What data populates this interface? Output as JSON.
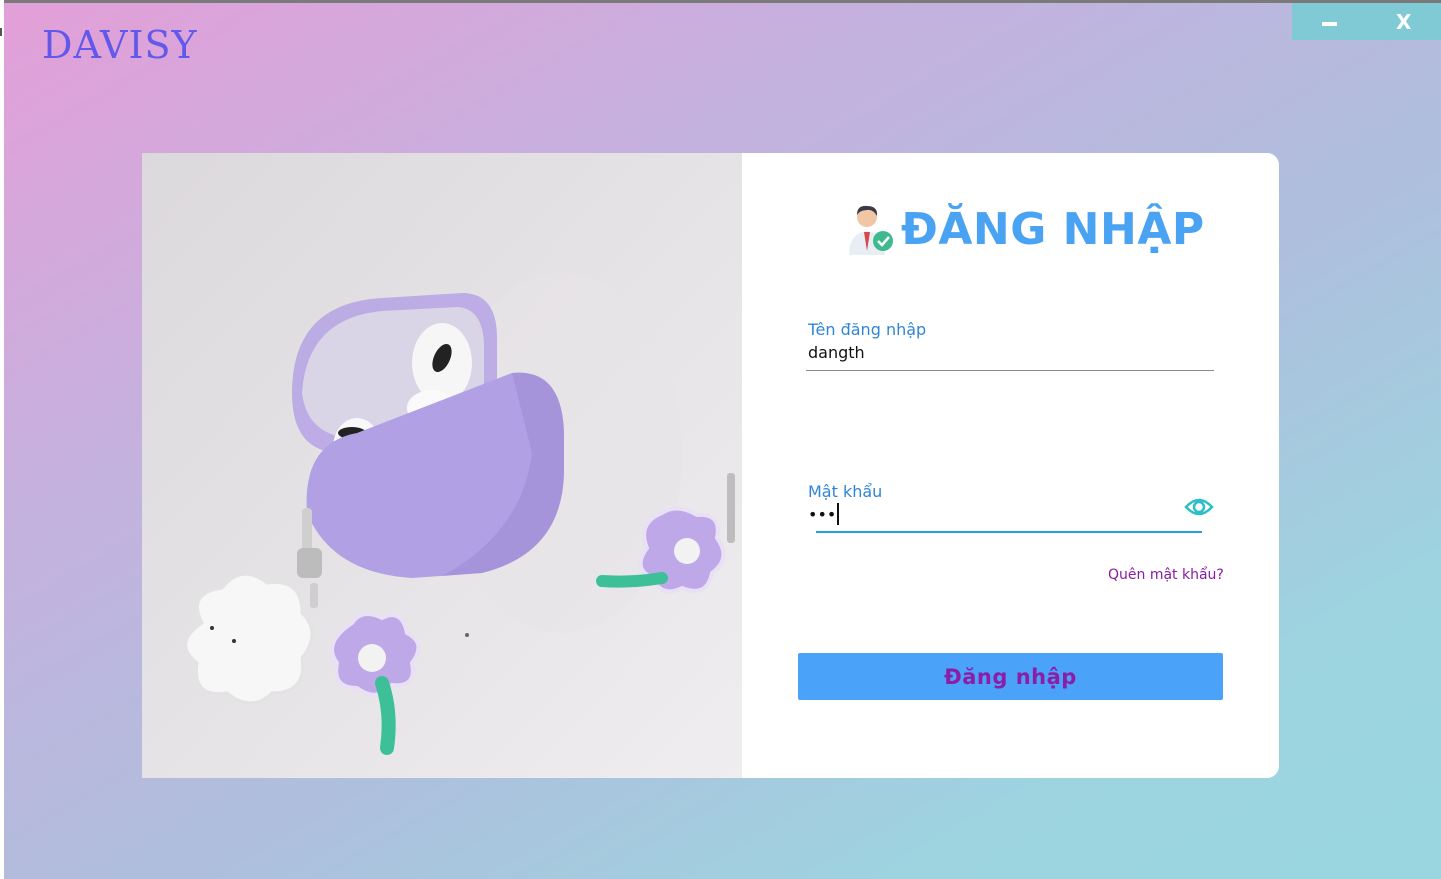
{
  "app": {
    "brand": "DAVISY"
  },
  "window_controls": {
    "minimize_icon": "minimize-icon",
    "close_label": "X"
  },
  "login": {
    "title": "ĐĂNG NHẬP",
    "title_icon": "user-check-icon",
    "username_label": "Tên đăng nhập",
    "username_value": "dangth",
    "password_label": "Mật khẩu",
    "password_masked": "•••",
    "show_password_icon": "eye-icon",
    "forgot_link": "Quên mật khẩu?",
    "submit_label": "Đăng nhập"
  },
  "colors": {
    "brand": "#6258ea",
    "accent": "#4aa3f8",
    "button_text": "#8b1da6",
    "label": "#2f86d6",
    "window_controls": "#7fcad4"
  }
}
